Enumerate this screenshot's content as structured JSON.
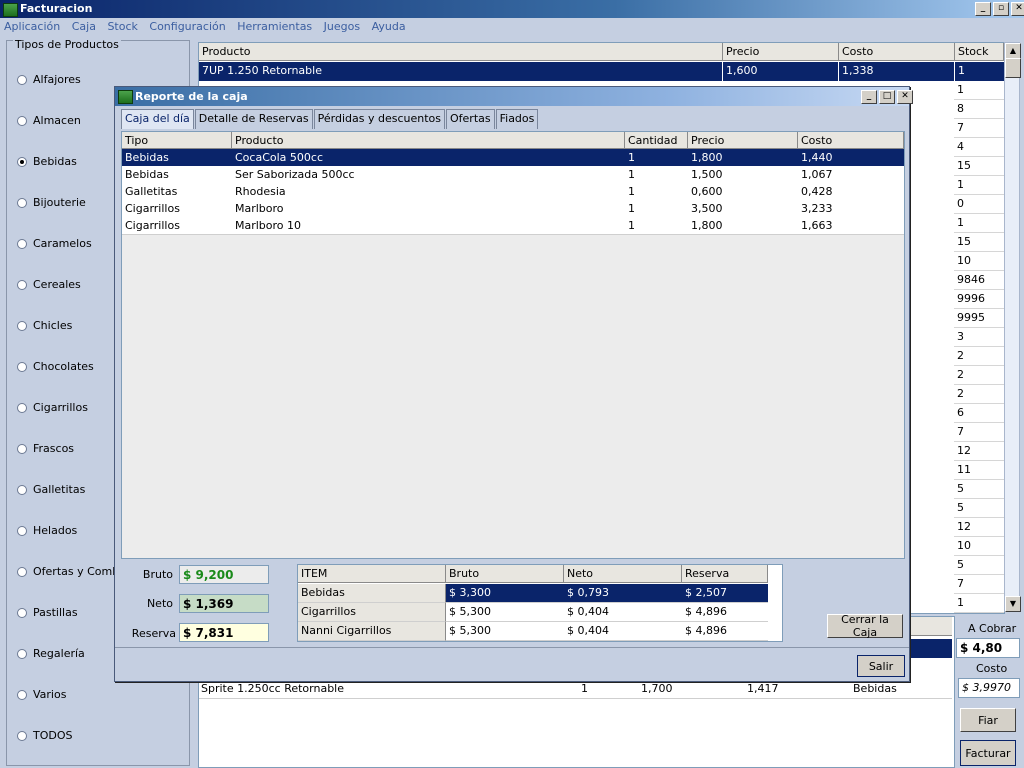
{
  "app": {
    "title": "Facturacion",
    "win_min": "_",
    "win_max": "▫",
    "win_close": "✕"
  },
  "menu": [
    "Aplicación",
    "Caja",
    "Stock",
    "Configuración",
    "Herramientas",
    "Juegos",
    "Ayuda"
  ],
  "sidebar": {
    "title": "Tipos de Productos",
    "selected": "Bebidas",
    "items": [
      "Alfajores",
      "Almacen",
      "Bebidas",
      "Bijouterie",
      "Caramelos",
      "Cereales",
      "Chicles",
      "Chocolates",
      "Cigarrillos",
      "Frascos",
      "Galletitas",
      "Helados",
      "Ofertas y Combos",
      "Pastillas",
      "Regalería",
      "Varios",
      "TODOS"
    ]
  },
  "products_table": {
    "headers": [
      "Producto",
      "Precio",
      "Costo",
      "Stock"
    ],
    "selected_row": {
      "producto": "7UP 1.250 Retornable",
      "precio": "1,600",
      "costo": "1,338",
      "stock": "1"
    },
    "stock_values": [
      "1",
      "8",
      "7",
      "4",
      "15",
      "1",
      "0",
      "1",
      "15",
      "10",
      "9846",
      "9996",
      "9995",
      "3",
      "2",
      "2",
      "2",
      "6",
      "7",
      "12",
      "11",
      "5",
      "5",
      "12",
      "10",
      "5",
      "7",
      "1"
    ]
  },
  "sales_table": {
    "visible_row": {
      "producto": "Sprite 1.250cc Retornable",
      "cantidad": "1",
      "precio": "1,700",
      "costo": "1,417",
      "tipo": "Bebidas"
    }
  },
  "right_panel": {
    "a_cobrar_label": "A Cobrar",
    "a_cobrar_value": "$ 4,80",
    "costo_label": "Costo",
    "costo_value": "$ 3,9970",
    "fiar_label": "Fiar",
    "facturar_label": "Facturar"
  },
  "dialog": {
    "title": "Reporte de la caja",
    "tabs": [
      "Caja del día",
      "Detalle de Reservas",
      "Pérdidas y descuentos",
      "Ofertas",
      "Fiados"
    ],
    "active_tab": 0,
    "grid": {
      "headers": [
        "Tipo",
        "Producto",
        "Cantidad",
        "Precio",
        "Costo"
      ],
      "rows": [
        [
          "Bebidas",
          "CocaCola 500cc",
          "1",
          "1,800",
          "1,440"
        ],
        [
          "Bebidas",
          "Ser Saborizada 500cc",
          "1",
          "1,500",
          "1,067"
        ],
        [
          "Galletitas",
          "Rhodesia",
          "1",
          "0,600",
          "0,428"
        ],
        [
          "Cigarrillos",
          "Marlboro",
          "1",
          "3,500",
          "3,233"
        ],
        [
          "Cigarrillos",
          "Marlboro 10",
          "1",
          "1,800",
          "1,663"
        ]
      ],
      "selected_row": 0
    },
    "summary": {
      "bruto_label": "Bruto",
      "bruto_value": "$ 9,200",
      "bruto_color": "#1a8a1a",
      "neto_label": "Neto",
      "neto_value": "$ 1,369",
      "neto_bg": "#c6dcc6",
      "reserva_label": "Reserva",
      "reserva_value": "$ 7,831",
      "reserva_bg": "#ffffe0"
    },
    "items": {
      "headers": [
        "ITEM",
        "Bruto",
        "Neto",
        "Reserva"
      ],
      "rows": [
        [
          "Bebidas",
          "$ 3,300",
          "$ 0,793",
          "$ 2,507"
        ],
        [
          "Cigarrillos",
          "$ 5,300",
          "$ 0,404",
          "$ 4,896"
        ],
        [
          "Nanni Cigarrillos",
          "$ 5,300",
          "$ 0,404",
          "$ 4,896"
        ]
      ],
      "selected_row": 0
    },
    "cerrar_label": "Cerrar la Caja",
    "salir_label": "Salir"
  }
}
